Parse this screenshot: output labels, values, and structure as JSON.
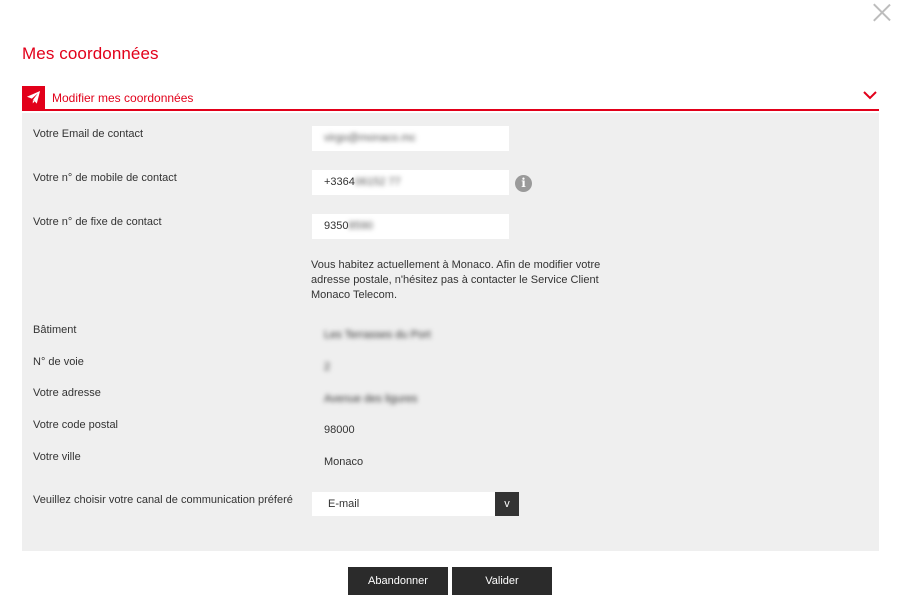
{
  "page": {
    "title": "Mes coordonnées"
  },
  "section": {
    "header_label": "Modifier mes coordonnées"
  },
  "form": {
    "email": {
      "label": "Votre Email de contact",
      "value": "virgo@monaco.mc"
    },
    "mobile": {
      "label": "Votre n° de mobile de contact",
      "value_visible": "+3364",
      "value_blurred": "06152 77"
    },
    "fixe": {
      "label": "Votre n° de fixe de contact",
      "value_visible": "9350",
      "value_blurred": "8590"
    },
    "address_note": "Vous habitez actuellement à Monaco. Afin de modifier votre adresse postale, n'hésitez pas à contacter le Service Client Monaco Telecom.",
    "batiment": {
      "label": "Bâtiment",
      "value": "Les Terrasses du Port"
    },
    "voie": {
      "label": "N° de voie",
      "value": "2"
    },
    "adresse": {
      "label": "Votre adresse",
      "value": "Avenue des ligures"
    },
    "code_postal": {
      "label": "Votre code postal",
      "value": "98000"
    },
    "ville": {
      "label": "Votre ville",
      "value": "Monaco"
    },
    "canal": {
      "label": "Veuillez choisir votre canal de communication préferé",
      "selected": "E-mail",
      "arrow": "v"
    }
  },
  "actions": {
    "cancel_label": "Abandonner",
    "validate_label": "Valider"
  },
  "colors": {
    "accent": "#e2001a",
    "panel_bg": "#efefef",
    "button_bg": "#2b2b2b"
  },
  "icons": {
    "close": "close-icon",
    "header": "paper-plane-icon",
    "chevron": "chevron-down-icon",
    "info": "info-icon"
  }
}
